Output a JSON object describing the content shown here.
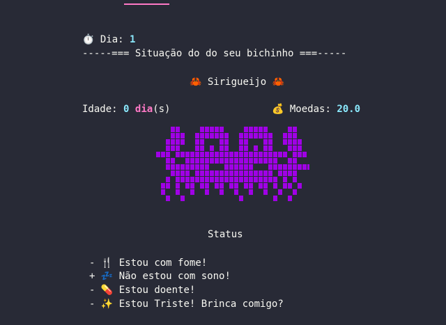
{
  "header": {
    "day_icon": "⏱️",
    "day_label": "Dia:",
    "day_value": "1",
    "section_title": "-----=== Situação do do seu bichinho ===-----"
  },
  "pet": {
    "icon": "🦀",
    "name": "Sirigueijo",
    "age_label": "Idade:",
    "age_value": "0",
    "age_unit": "dia",
    "age_suffix": "(s)",
    "coins_icon": "💰",
    "coins_label": "Moedas:",
    "coins_value": "20.0"
  },
  "status": {
    "title": "Status",
    "items": [
      {
        "sign": "-",
        "icon": "🍴",
        "text": "Estou com fome!"
      },
      {
        "sign": "+",
        "icon": "💤",
        "text": "Não estou com sono!"
      },
      {
        "sign": "-",
        "icon": "💊",
        "text": "Estou doente!"
      },
      {
        "sign": "-",
        "icon": "✨",
        "text": "Estou Triste! Brinca comigo?"
      }
    ]
  },
  "colors": {
    "background": "#282a36",
    "text": "#f8f8f2",
    "accent_cyan": "#8be9fd",
    "accent_pink": "#ff79c6",
    "sprite": "#a000e6"
  }
}
